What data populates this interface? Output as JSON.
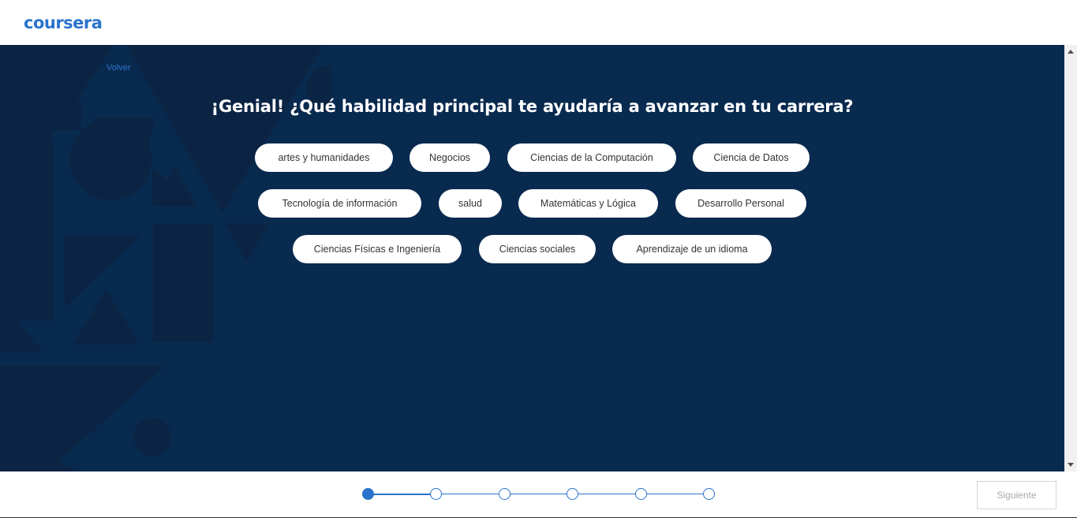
{
  "header": {
    "logo_text": "coursera"
  },
  "main": {
    "back_label": "Volver",
    "question": "¡Genial! ¿Qué habilidad principal te ayudaría a avanzar en tu carrera?",
    "options": [
      "artes y humanidades",
      "Negocios",
      "Ciencias de la Computación",
      "Ciencia de Datos",
      "Tecnología de información",
      "salud",
      "Matemáticas y Lógica",
      "Desarrollo Personal",
      "Ciencias Físicas e Ingeniería",
      "Ciencias sociales",
      "Aprendizaje de un idioma"
    ]
  },
  "progress": {
    "total_steps": 6,
    "current_step": 1
  },
  "footer": {
    "next_label": "Siguiente"
  },
  "colors": {
    "brand": "#2a73cc",
    "panel": "#092a4f",
    "shape": "#0b2444"
  }
}
